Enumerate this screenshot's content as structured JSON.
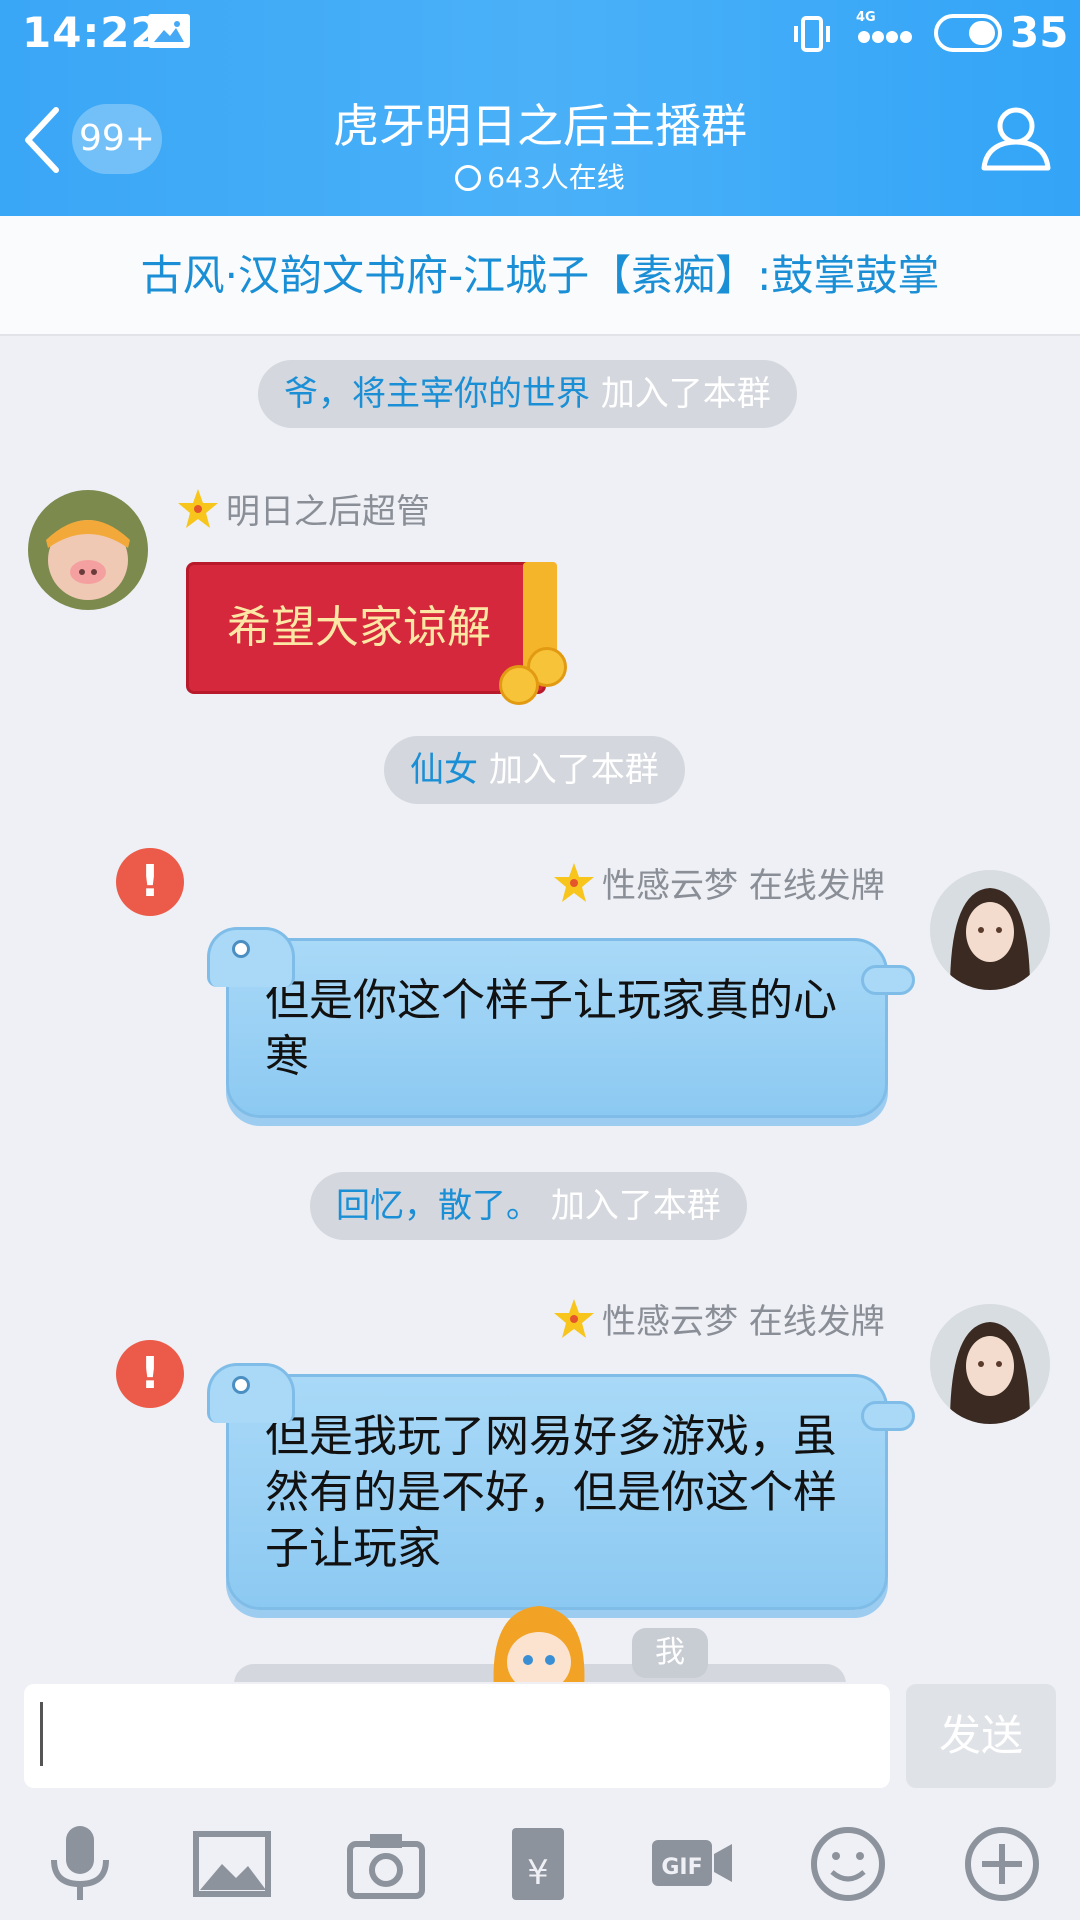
{
  "status_bar": {
    "time": "14:22",
    "network": "4G",
    "battery": "35"
  },
  "header": {
    "unread_badge": "99+",
    "title": "虎牙明日之后主播群",
    "online_text": "643人在线"
  },
  "announcement": "古风·汉韵文书府-江城子【素痴】:鼓掌鼓掌",
  "messages": [
    {
      "type": "system",
      "name": "爷，将主宰你的世界",
      "action": "加入了本群"
    },
    {
      "type": "redpacket",
      "sender": "明日之后超管",
      "text": "希望大家谅解"
    },
    {
      "type": "system",
      "name": "仙女",
      "action": "加入了本群"
    },
    {
      "type": "bubble",
      "sender": "性感云梦 在线发牌",
      "text": "但是你这个样子让玩家真的心寒"
    },
    {
      "type": "system",
      "name": "回忆，散了。",
      "action": "加入了本群"
    },
    {
      "type": "bubble",
      "sender": "性感云梦 在线发牌",
      "text": "但是我玩了网易好多游戏，虽然有的是不好，但是你这个样子让玩家"
    }
  ],
  "me_tag": "我",
  "input": {
    "placeholder": "",
    "value": "",
    "send_label": "发送"
  },
  "toolbar": [
    "microphone-icon",
    "image-icon",
    "camera-icon",
    "red-envelope-icon",
    "gif-icon",
    "emoji-icon",
    "plus-icon"
  ],
  "colors": {
    "header": "#3aa6f6",
    "link": "#1b8fd6",
    "bubble": "#a9d9f7",
    "error": "#ec5b49",
    "redpacket": "#d5283d"
  }
}
